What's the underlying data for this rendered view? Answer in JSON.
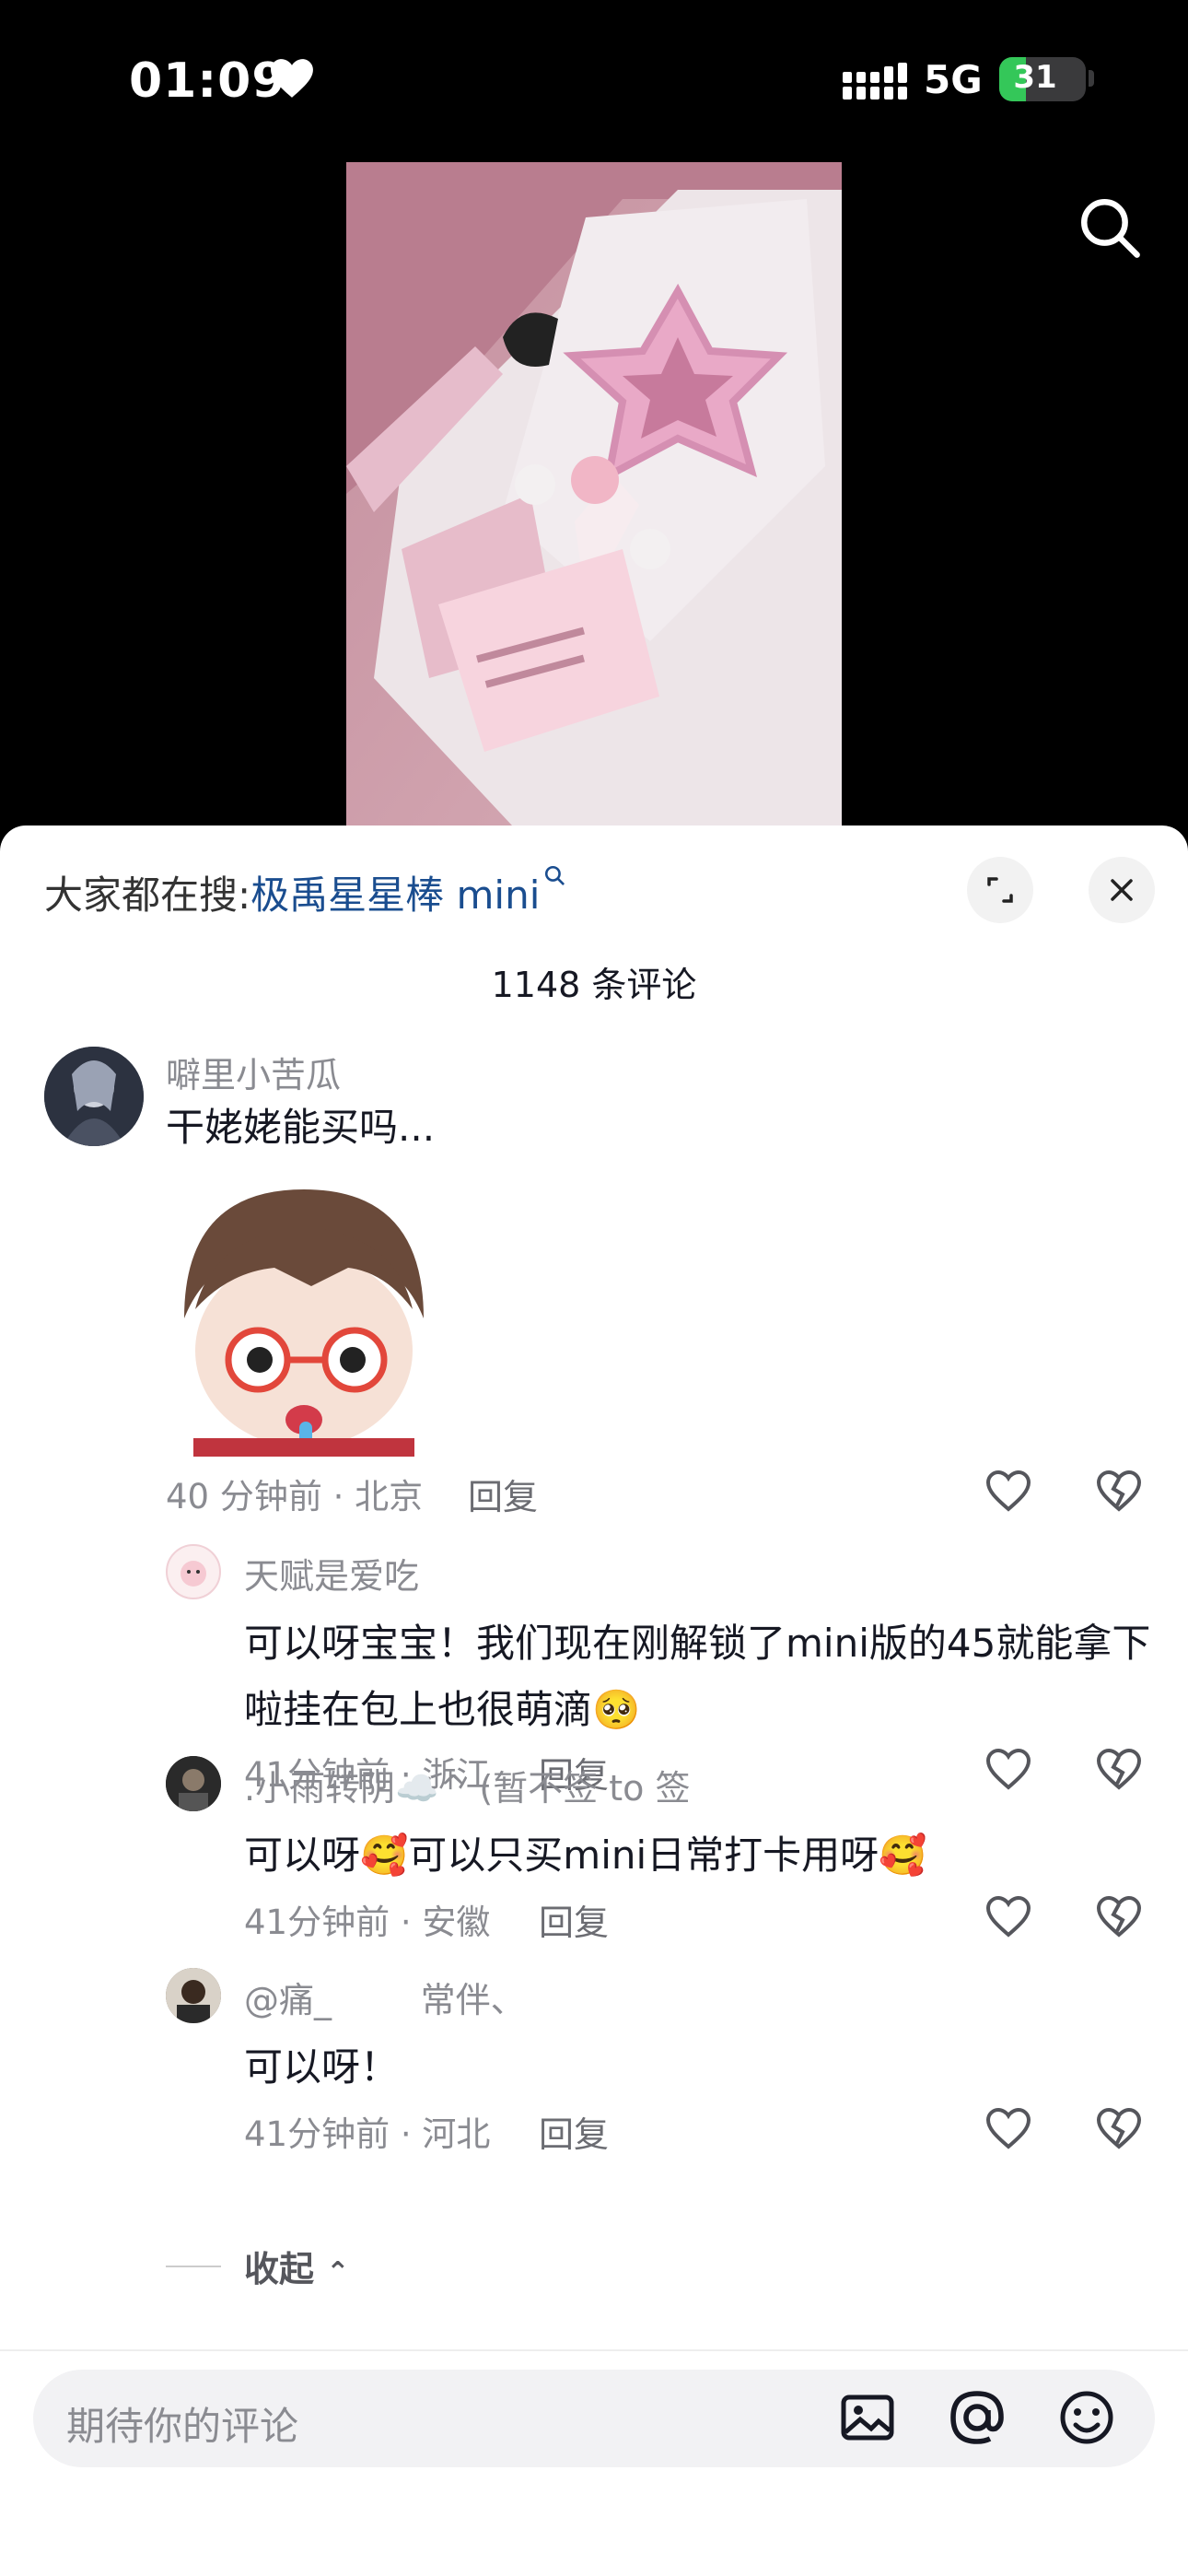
{
  "status_bar": {
    "time": "01:09",
    "network": "5G",
    "battery": "31",
    "battery_level": 0.31
  },
  "hot_search": {
    "prefix": "大家都在搜:",
    "keyword": "极禹星星棒 mini"
  },
  "comment_count": "1148 条评论",
  "comments": [
    {
      "username": "噼里小苦瓜",
      "text": "干姥姥能买吗...",
      "time_location": "40 分钟前 · 北京",
      "reply": "回复"
    },
    {
      "username": "天赋是爱吃",
      "text": "可以呀宝宝！我们现在刚解锁了mini版的45就能拿下啦挂在包上也很萌滴🥺",
      "time_location": "41分钟前 · 浙江",
      "reply": "回复"
    },
    {
      "username": ".小雨转阴☁️^ (暂不签 to 签",
      "text": "可以呀🥰可以只买mini日常打卡用呀🥰",
      "time_location": "41分钟前 · 安徽",
      "reply": "回复"
    },
    {
      "username": "@痛_        常伴、",
      "text": "可以呀！",
      "time_location": "41分钟前 · 河北",
      "reply": "回复"
    }
  ],
  "collapse_label": "收起",
  "input": {
    "placeholder": "期待你的评论"
  },
  "colors": {
    "link": "#1a4d8f",
    "battery": "#34c759",
    "sheet_bg": "#ffffff"
  },
  "icons": [
    "heart-icon",
    "signal-icon",
    "search-icon",
    "expand-icon",
    "close-icon",
    "like-icon",
    "dislike-icon",
    "image-icon",
    "at-icon",
    "emoji-icon"
  ]
}
